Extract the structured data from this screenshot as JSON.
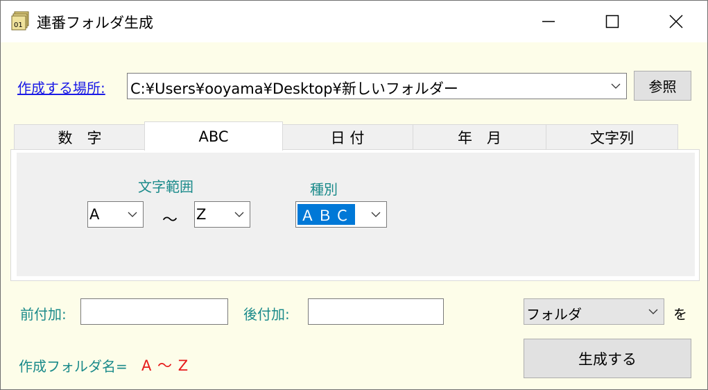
{
  "window": {
    "title": "連番フォルダ生成",
    "controls": {
      "minimize_icon": "minimize-icon",
      "maximize_icon": "maximize-icon",
      "close_icon": "close-icon"
    }
  },
  "location": {
    "label": "作成する場所:",
    "path": "C:¥Users¥ooyama¥Desktop¥新しいフォルダー",
    "browse_label": "参照"
  },
  "tabs": [
    {
      "label": "数　字",
      "active": false
    },
    {
      "label": "ABC",
      "active": true
    },
    {
      "label": "日 付",
      "active": false
    },
    {
      "label": "年　月",
      "active": false
    },
    {
      "label": "文字列",
      "active": false
    }
  ],
  "abc_panel": {
    "range_label": "文字範囲",
    "range_from": "A",
    "range_separator": "～",
    "range_to": "Z",
    "kind_label": "種別",
    "kind_value": "ＡＢＣ"
  },
  "affix": {
    "prefix_label": "前付加:",
    "prefix_value": "",
    "suffix_label": "後付加:",
    "suffix_value": "",
    "type_value": "フォルダ",
    "type_suffix": "を"
  },
  "result": {
    "name_label": "作成フォルダ名=",
    "name_value": "A ～ Z",
    "generate_label": "生成する"
  },
  "colors": {
    "window_bg": "#fdfde9",
    "teal_label": "#1a8a8a",
    "link": "#1a1ae6",
    "result_red": "#e61a1a",
    "selection": "#0078d7"
  }
}
